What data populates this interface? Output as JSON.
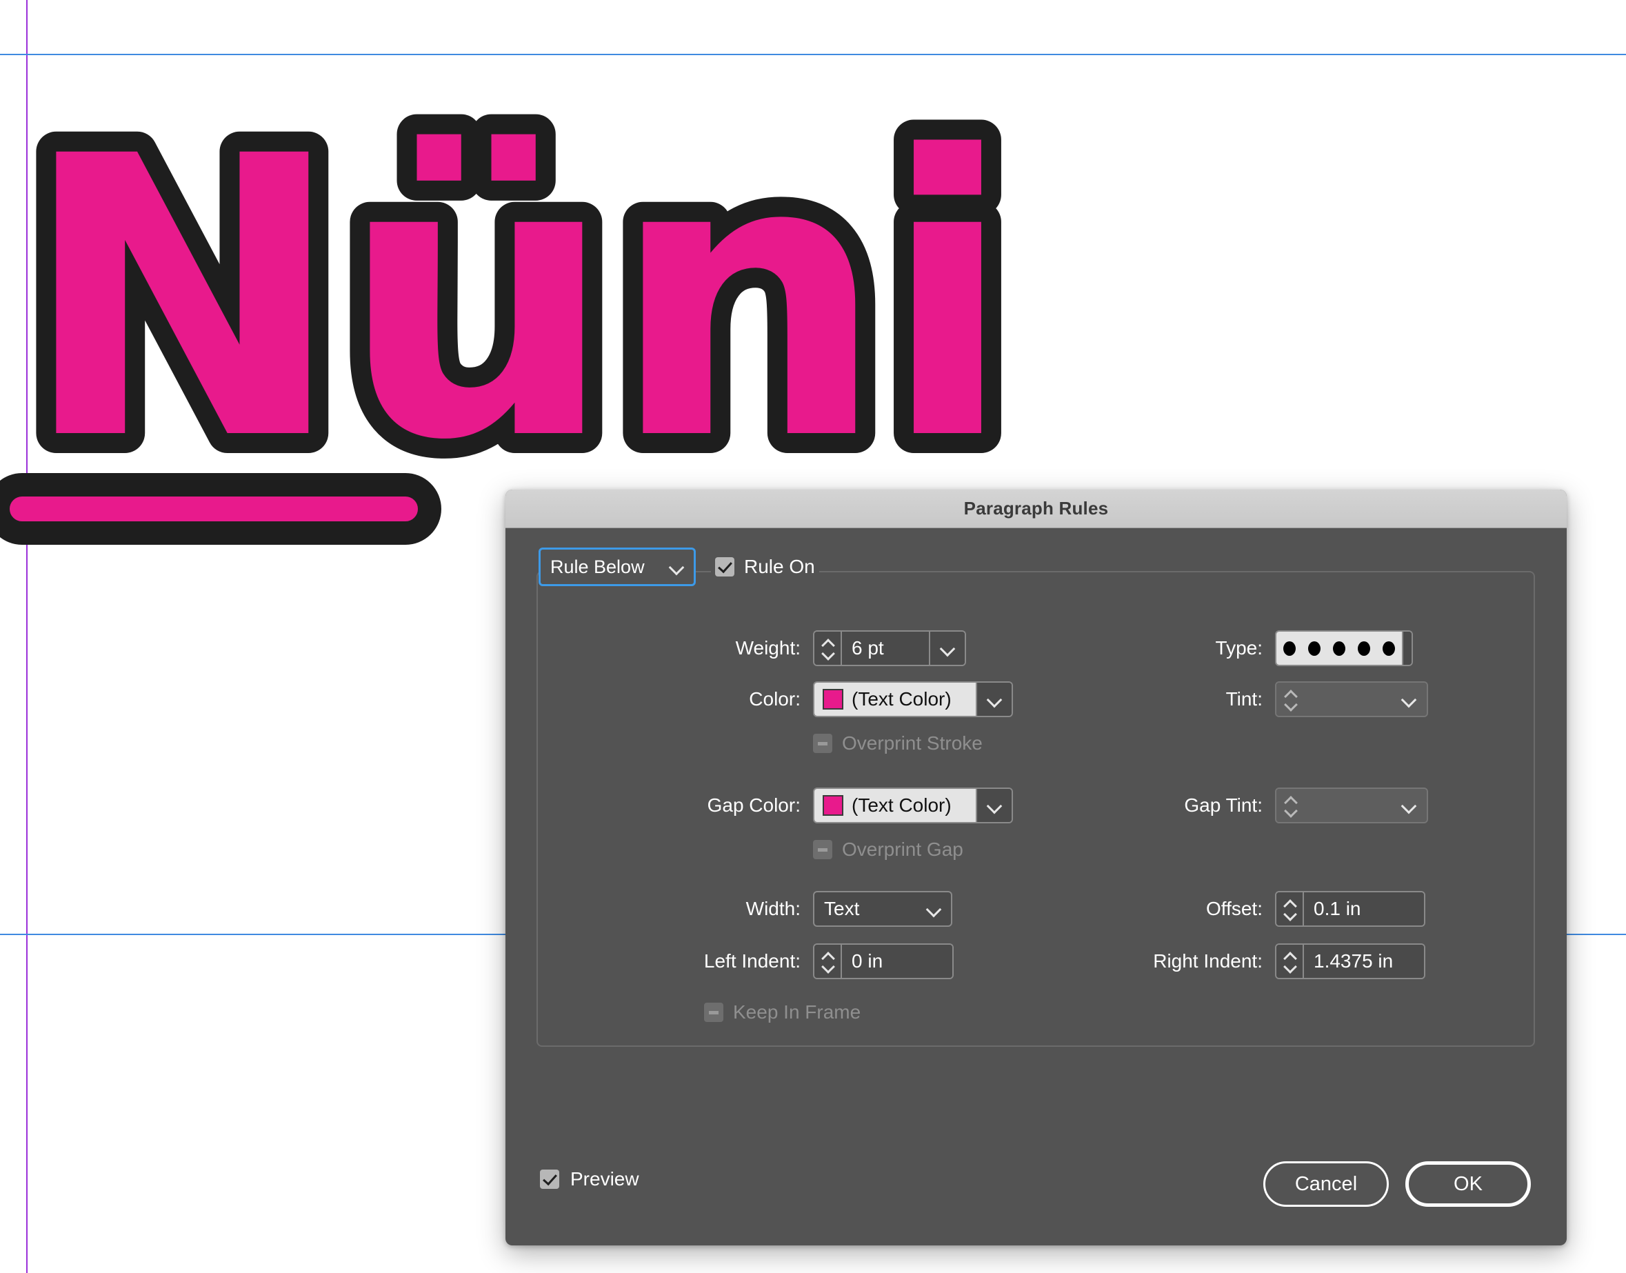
{
  "canvas": {
    "artwork_text": "Nüni",
    "artwork_fill": "#E81A8C",
    "artwork_stroke": "#1E1E1E",
    "rule_color": "#E81A8C",
    "guide_color_horizontal": "#3F8AE0",
    "guide_color_vertical": "#9B30D9"
  },
  "dialog": {
    "title": "Paragraph Rules",
    "rule_select": {
      "value": "Rule Below",
      "icon": "chevron-down-icon"
    },
    "rule_on": {
      "label": "Rule On",
      "checked": true
    },
    "weight": {
      "label": "Weight:",
      "value": "6 pt"
    },
    "type": {
      "label": "Type:",
      "value": "dotted",
      "dot_count": 5
    },
    "color": {
      "label": "Color:",
      "value": "(Text Color)",
      "swatch": "#E81A8C"
    },
    "tint": {
      "label": "Tint:",
      "value": "",
      "disabled": true
    },
    "overprint_stroke": {
      "label": "Overprint Stroke",
      "state": "indeterminate",
      "disabled": true
    },
    "gap_color": {
      "label": "Gap Color:",
      "value": "(Text Color)",
      "swatch": "#E81A8C"
    },
    "gap_tint": {
      "label": "Gap Tint:",
      "value": "",
      "disabled": true
    },
    "overprint_gap": {
      "label": "Overprint Gap",
      "state": "indeterminate",
      "disabled": true
    },
    "width": {
      "label": "Width:",
      "value": "Text"
    },
    "offset": {
      "label": "Offset:",
      "value": "0.1 in"
    },
    "left_indent": {
      "label": "Left Indent:",
      "value": "0 in"
    },
    "right_indent": {
      "label": "Right Indent:",
      "value": "1.4375 in"
    },
    "keep_in_frame": {
      "label": "Keep In Frame",
      "state": "indeterminate",
      "disabled": true
    },
    "preview": {
      "label": "Preview",
      "checked": true
    },
    "cancel_label": "Cancel",
    "ok_label": "OK"
  }
}
